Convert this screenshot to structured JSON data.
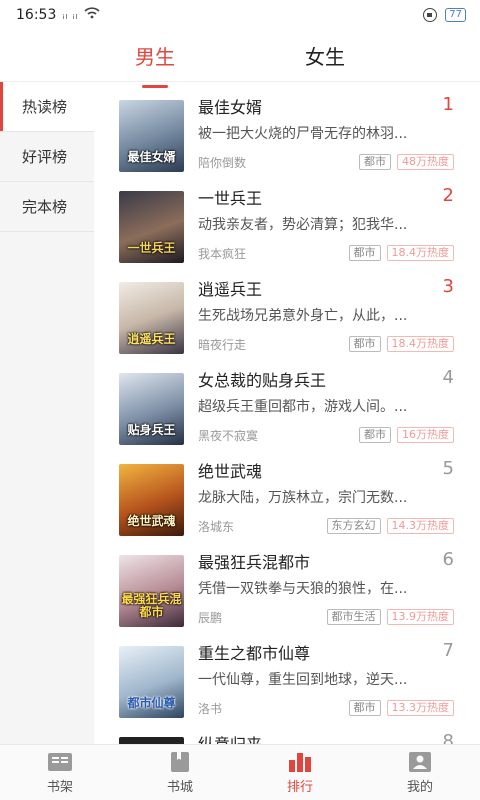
{
  "status": {
    "time": "16:53",
    "signal": "ᵢₗ ᵢₗ",
    "battery": "77"
  },
  "header": {
    "tabs": [
      {
        "label": "男生"
      },
      {
        "label": "女生"
      }
    ]
  },
  "sidebar": {
    "items": [
      {
        "label": "热读榜"
      },
      {
        "label": "好评榜"
      },
      {
        "label": "完本榜"
      }
    ]
  },
  "books": [
    {
      "rank": "1",
      "title": "最佳女婿",
      "desc": "被一把大火烧的尸骨无存的林羽...",
      "author": "陪你倒数",
      "tag": "都市",
      "heat": "48万热度",
      "cover_text": "最佳女婿"
    },
    {
      "rank": "2",
      "title": "一世兵王",
      "desc": "动我亲友者，势必清算；犯我华...",
      "author": "我本疯狂",
      "tag": "都市",
      "heat": "18.4万热度",
      "cover_text": "一世兵王"
    },
    {
      "rank": "3",
      "title": "逍遥兵王",
      "desc": "生死战场兄弟意外身亡，从此，...",
      "author": "暗夜行走",
      "tag": "都市",
      "heat": "18.4万热度",
      "cover_text": "逍遥兵王"
    },
    {
      "rank": "4",
      "title": "女总裁的贴身兵王",
      "desc": "超级兵王重回都市，游戏人间。...",
      "author": "黑夜不寂寞",
      "tag": "都市",
      "heat": "16万热度",
      "cover_text": "贴身兵王"
    },
    {
      "rank": "5",
      "title": "绝世武魂",
      "desc": "龙脉大陆，万族林立，宗门无数...",
      "author": "洛城东",
      "tag": "东方玄幻",
      "heat": "14.3万热度",
      "cover_text": "绝世武魂"
    },
    {
      "rank": "6",
      "title": "最强狂兵混都市",
      "desc": "凭借一双铁拳与天狼的狼性，在...",
      "author": "辰鹏",
      "tag": "都市生活",
      "heat": "13.9万热度",
      "cover_text": "最强狂兵混都市"
    },
    {
      "rank": "7",
      "title": "重生之都市仙尊",
      "desc": "一代仙尊，重生回到地球，逆天...",
      "author": "洛书",
      "tag": "都市",
      "heat": "13.3万热度",
      "cover_text": "都市仙尊"
    },
    {
      "rank": "8",
      "title": "纵意归来",
      "desc": "",
      "author": "",
      "tag": "",
      "heat": "",
      "cover_text": ""
    }
  ],
  "bottom_nav": {
    "items": [
      {
        "label": "书架",
        "icon": "bookshelf-icon"
      },
      {
        "label": "书城",
        "icon": "bookstore-icon"
      },
      {
        "label": "排行",
        "icon": "ranking-icon"
      },
      {
        "label": "我的",
        "icon": "profile-icon"
      }
    ]
  },
  "colors": {
    "accent": "#e0463e"
  }
}
